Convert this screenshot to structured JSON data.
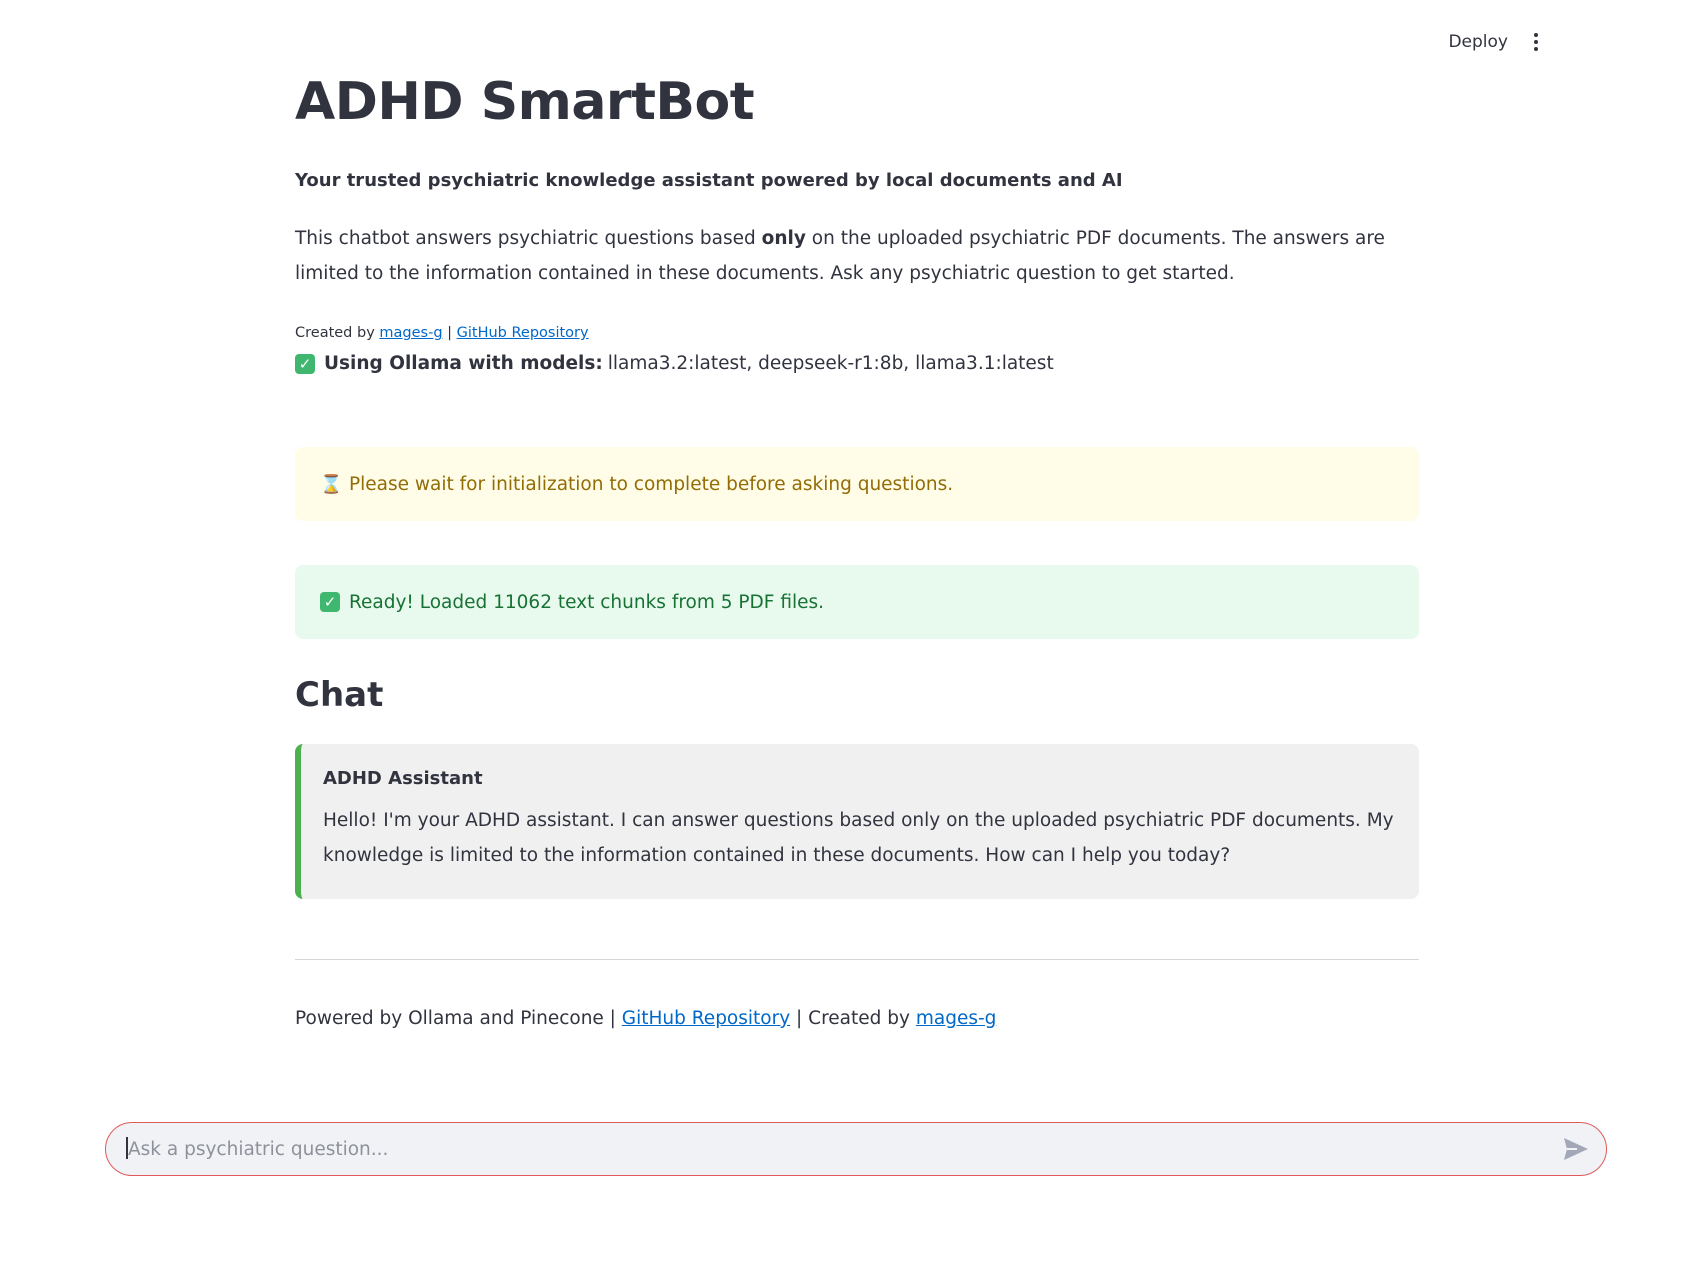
{
  "header": {
    "deploy_label": "Deploy",
    "menu_icon": "vertical-ellipsis-icon"
  },
  "page": {
    "title": "ADHD SmartBot",
    "subtitle": "Your trusted psychiatric knowledge assistant powered by local documents and AI",
    "description": {
      "before": "This chatbot answers psychiatric questions based ",
      "emphasis": "only",
      "after": " on the uploaded psychiatric PDF documents. The answers are limited to the information contained in these documents. Ask any psychiatric question to get started."
    },
    "credits": {
      "prefix": "Created by ",
      "author_link": "mages-g",
      "separator": " | ",
      "repo_link": "GitHub Repository"
    },
    "models": {
      "icon": "check-mark-icon",
      "label": "Using Ollama with models:",
      "value": "llama3.2:latest, deepseek-r1:8b, llama3.1:latest"
    }
  },
  "alerts": {
    "warning": {
      "icon": "hourglass-icon",
      "text": "Please wait for initialization to complete before asking questions.",
      "background": "#fffce7",
      "color": "#926c05"
    },
    "success": {
      "icon": "check-mark-icon",
      "text": "Ready! Loaded 11062 text chunks from 5 PDF files.",
      "background": "#e8f9ee",
      "color": "#177233"
    }
  },
  "chat": {
    "heading": "Chat",
    "messages": [
      {
        "sender": "ADHD Assistant",
        "text": "Hello! I'm your ADHD assistant. I can answer questions based only on the uploaded psychiatric PDF documents. My knowledge is limited to the information contained in these documents. How can I help you today?"
      }
    ]
  },
  "footer": {
    "prefix": "Powered by Ollama and Pinecone | ",
    "repo_link": "GitHub Repository",
    "middle": " | Created by ",
    "author_link": "mages-g"
  },
  "chat_input": {
    "placeholder": "Ask a psychiatric question...",
    "value": "",
    "send_icon": "send-icon"
  },
  "colors": {
    "accent_link": "#0068c9",
    "chat_border": "#4caf50",
    "input_border": "#e05a5a"
  }
}
